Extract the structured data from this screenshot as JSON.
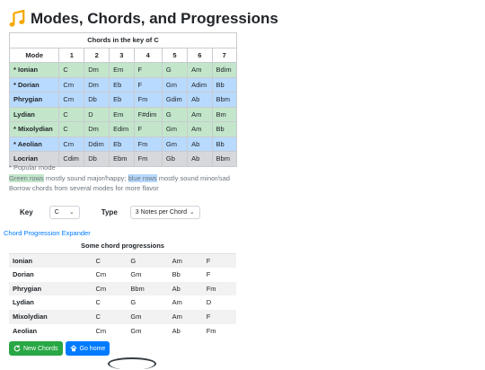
{
  "page": {
    "title": "Modes, Chords, and Progressions",
    "icon": "music-note-icon"
  },
  "modes_table": {
    "caption": "Chords in the key of C",
    "headers": [
      "Mode",
      "1",
      "2",
      "3",
      "4",
      "5",
      "6",
      "7"
    ],
    "rows": [
      {
        "type": "green",
        "cells": [
          "* Ionian",
          "C",
          "Dm",
          "Em",
          "F",
          "G",
          "Am",
          "Bdim"
        ]
      },
      {
        "type": "blue",
        "cells": [
          "* Dorian",
          "Cm",
          "Dm",
          "Eb",
          "F",
          "Gm",
          "Adim",
          "Bb"
        ]
      },
      {
        "type": "blue",
        "cells": [
          "Phrygian",
          "Cm",
          "Db",
          "Eb",
          "Fm",
          "Gdim",
          "Ab",
          "Bbm"
        ]
      },
      {
        "type": "green",
        "cells": [
          "Lydian",
          "C",
          "D",
          "Em",
          "F#dim",
          "G",
          "Am",
          "Bm"
        ]
      },
      {
        "type": "green",
        "cells": [
          "* Mixolydian",
          "C",
          "Dm",
          "Edim",
          "F",
          "Gm",
          "Am",
          "Bb"
        ]
      },
      {
        "type": "blue",
        "cells": [
          "* Aeolian",
          "Cm",
          "Ddim",
          "Eb",
          "Fm",
          "Gm",
          "Ab",
          "Bb"
        ]
      },
      {
        "type": "gray",
        "cells": [
          "Locrian",
          "Cdim",
          "Db",
          "Ebm",
          "Fm",
          "Gb",
          "Ab",
          "Bbm"
        ]
      }
    ]
  },
  "notes": {
    "popular": "* Popular mode",
    "green_rows": "Green rows",
    "green_desc": " mostly sound major/happy; ",
    "blue_rows": "blue rows",
    "blue_desc": " mostly sound minor/sad",
    "borrow": "Borrow chords from several modes for more flavor"
  },
  "controls": {
    "key_label": "Key",
    "key_value": "C",
    "type_label": "Type",
    "type_value": "3 Notes per Chord"
  },
  "expander_label": "Chord Progression Expander",
  "progressions": {
    "caption": "Some chord progressions",
    "rows": [
      [
        "Ionian",
        "C",
        "G",
        "Am",
        "F"
      ],
      [
        "Dorian",
        "Cm",
        "Gm",
        "Bb",
        "F"
      ],
      [
        "Phrygian",
        "Cm",
        "Bbm",
        "Ab",
        "Fm"
      ],
      [
        "Lydian",
        "C",
        "G",
        "Am",
        "D"
      ],
      [
        "Mixolydian",
        "C",
        "Gm",
        "Am",
        "F"
      ],
      [
        "Aeolian",
        "Cm",
        "Gm",
        "Ab",
        "Fm"
      ]
    ]
  },
  "buttons": {
    "new_chords": "New Chords",
    "new_chords_icon": "refresh-icon",
    "go_home": "Go home",
    "go_home_icon": "home-icon"
  },
  "colors": {
    "green_row": "#c3e6cb",
    "blue_row": "#b8daff",
    "gray_row": "#d6d8db",
    "link": "#007bff",
    "success": "#28a745",
    "note_icon": "#f5a800"
  }
}
